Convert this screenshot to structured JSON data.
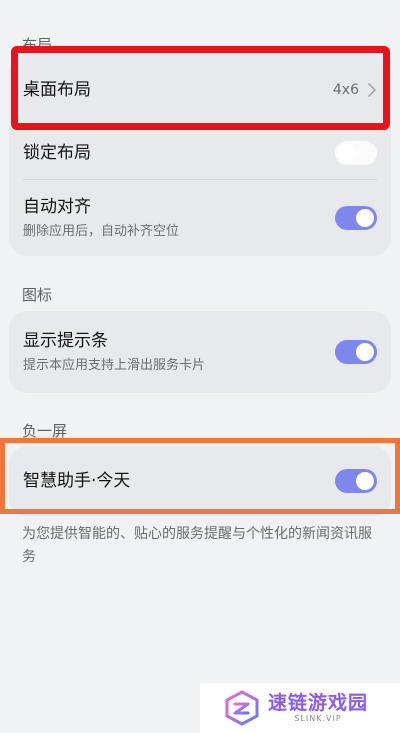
{
  "sections": {
    "layout_label": "布局",
    "icons_label": "图标",
    "minus_one_label": "负一屏"
  },
  "layout_card": {
    "desktop_layout": {
      "title": "桌面布局",
      "value": "4x6"
    },
    "lock_layout": {
      "title": "锁定布局",
      "toggle": "off"
    },
    "auto_align": {
      "title": "自动对齐",
      "subtitle": "删除应用后，自动补齐空位",
      "toggle": "on"
    }
  },
  "icons_card": {
    "show_hint_bar": {
      "title": "显示提示条",
      "subtitle": "提示本应用支持上滑出服务卡片",
      "toggle": "on"
    }
  },
  "minus_one_card": {
    "smart_assistant": {
      "title": "智慧助手·今天",
      "toggle": "on"
    }
  },
  "footer_note": "为您提供智能的、贴心的服务提醒与个性化的新闻资讯服务",
  "watermark": {
    "name": "速链游戏园",
    "sub": "SLINK.VIP"
  },
  "colors": {
    "toggle_on": "#7d87ec",
    "highlight_red": "#e8141c",
    "highlight_orange": "#f0763e",
    "watermark_purple": "#8a5cf0"
  },
  "icons": [
    "chevron-right-icon",
    "watermark-logo-icon"
  ]
}
